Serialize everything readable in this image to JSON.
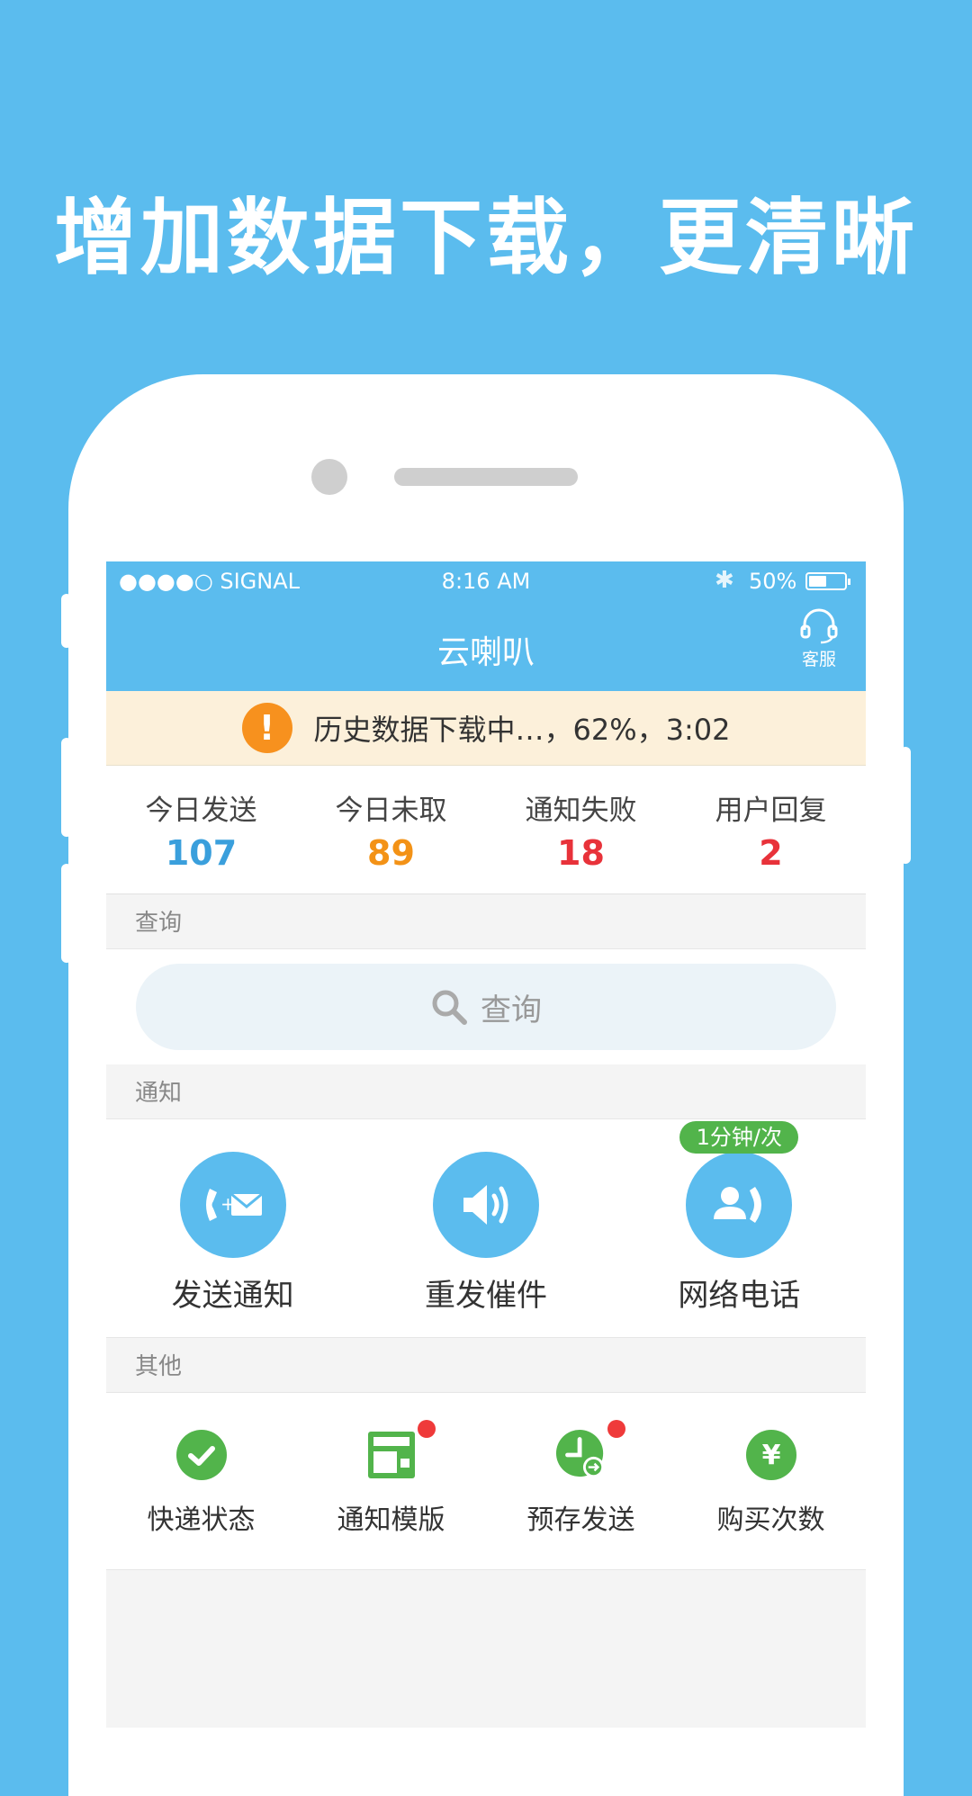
{
  "headline": "增加数据下载，更清晰",
  "status_bar": {
    "signal": "●●●●○ SIGNAL",
    "time": "8:16 AM",
    "battery": "50%",
    "battery_level": 0.5
  },
  "nav": {
    "title": "云喇叭",
    "service_label": "客服"
  },
  "banner": {
    "text": "历史数据下载中…，62%，3:02"
  },
  "stats": [
    {
      "label": "今日发送",
      "value": "107",
      "color": "#3a9fdc"
    },
    {
      "label": "今日未取",
      "value": "89",
      "color": "#f39216"
    },
    {
      "label": "通知失败",
      "value": "18",
      "color": "#e8323a"
    },
    {
      "label": "用户回复",
      "value": "2",
      "color": "#e8323a"
    }
  ],
  "sections": {
    "query": "查询",
    "notify": "通知",
    "other": "其他"
  },
  "search": {
    "placeholder": "查询"
  },
  "notify_items": [
    {
      "label": "发送通知",
      "icon": "phone-mail-icon"
    },
    {
      "label": "重发催件",
      "icon": "speaker-icon"
    },
    {
      "label": "网络电话",
      "icon": "user-phone-icon",
      "badge": "1分钟/次"
    }
  ],
  "other_items": [
    {
      "label": "快递状态",
      "icon": "check-circle-icon"
    },
    {
      "label": "通知模版",
      "icon": "template-icon",
      "dot": true
    },
    {
      "label": "预存发送",
      "icon": "clock-send-icon",
      "dot": true
    },
    {
      "label": "购买次数",
      "icon": "yen-circle-icon"
    }
  ],
  "colors": {
    "brand": "#5bbcee",
    "green": "#52b44b",
    "orange": "#f7911e",
    "red": "#ef3a3a"
  }
}
